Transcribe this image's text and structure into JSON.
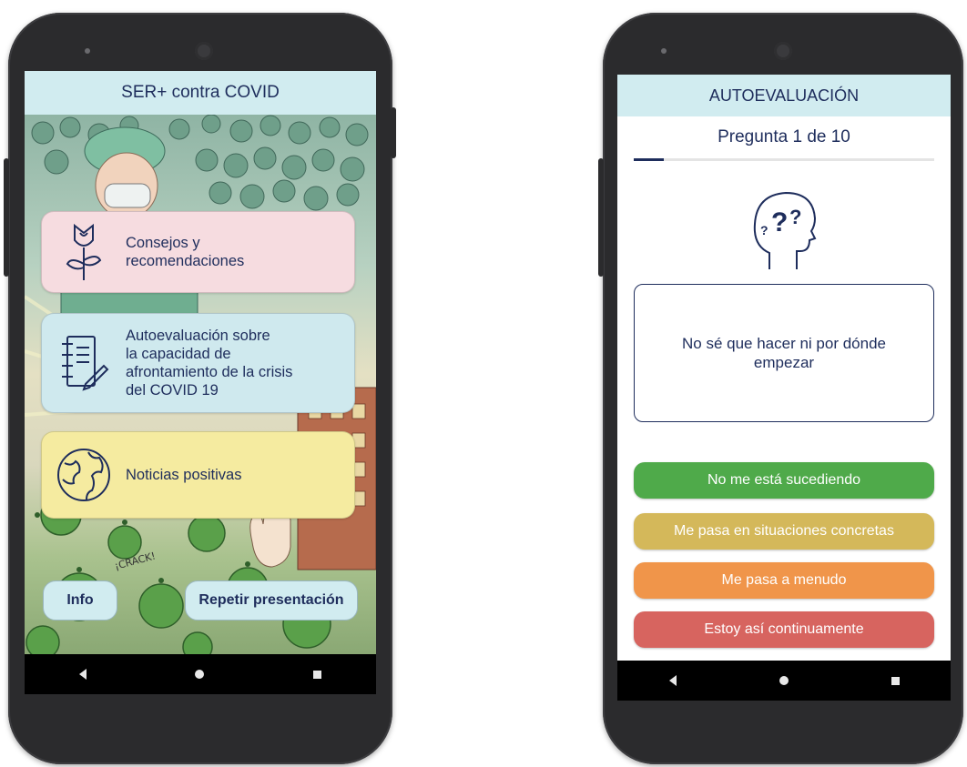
{
  "left_screen": {
    "title": "SER+ contra COVID",
    "cards": [
      {
        "label": "Consejos y\nrecomendaciones",
        "icon": "rose-icon",
        "color": "#f6dce0"
      },
      {
        "label": "Autoevaluación sobre\nla capacidad de\nafrontamiento de la crisis\ndel COVID 19",
        "icon": "notebook-pencil-icon",
        "color": "#cfe9ee"
      },
      {
        "label": "Noticias positivas",
        "icon": "globe-icon",
        "color": "#f5eba0"
      }
    ],
    "info_label": "Info",
    "repeat_label": "Repetir presentación"
  },
  "right_screen": {
    "title": "AUTOEVALUACIÓN",
    "question_counter": "Pregunta 1 de 10",
    "progress": 0.1,
    "icon": "thinking-head-icon",
    "question_text": "No sé que hacer ni por dónde empezar",
    "answers": [
      {
        "label": "No me está sucediendo",
        "color": "#4faa4a"
      },
      {
        "label": "Me pasa en situaciones concretas",
        "color": "#d4b85a"
      },
      {
        "label": "Me pasa a menudo",
        "color": "#f0954a"
      },
      {
        "label": "Estoy así continuamente",
        "color": "#d7645f"
      }
    ]
  },
  "colors": {
    "accent": "#1e2d5c",
    "header": "#d1ecf0"
  }
}
